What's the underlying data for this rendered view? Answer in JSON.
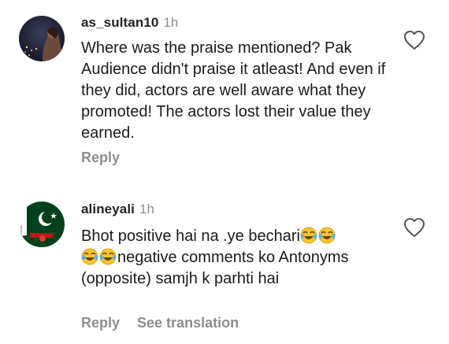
{
  "comments": [
    {
      "username": "as_sultan10",
      "time": "1h",
      "text": "Where was the praise mentioned? Pak Audience didn't praise it atleast! And even if they did, actors are well aware what they promoted! The actors lost their value they earned.",
      "reply_label": "Reply"
    },
    {
      "username": "alineyali",
      "time": "1h",
      "text_part1": "Bhot positive hai na .ye bechari",
      "text_part2": "negative comments ko Antonyms (opposite) samjh k parhti hai",
      "reply_label": "Reply",
      "translation_label": "See translation"
    }
  ],
  "icons": {
    "like": "heart-outline-icon",
    "emoji": "face-with-tears-of-joy-emoji"
  },
  "colors": {
    "muted_text": "#8e8e8e",
    "flag_green": "#01411c",
    "background": "#ffffff"
  }
}
